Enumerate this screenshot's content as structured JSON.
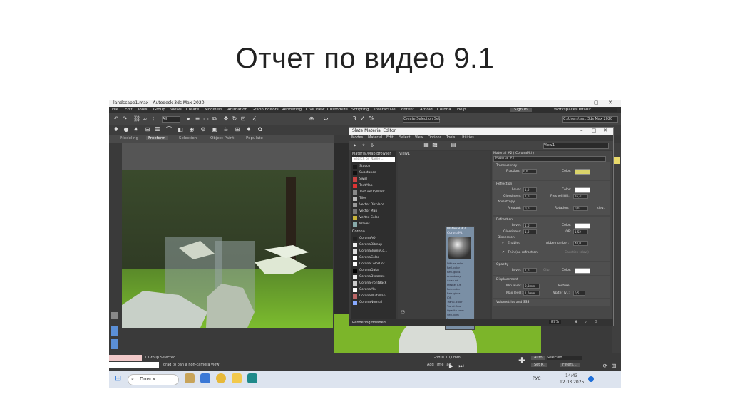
{
  "slide": {
    "title": "Отчет по видео 9.1"
  },
  "app": {
    "window_title": "landscape1.max - Autodesk 3ds Max 2020",
    "menu": [
      "File",
      "Edit",
      "Tools",
      "Group",
      "Views",
      "Create",
      "Modifiers",
      "Animation",
      "Graph Editors",
      "Rendering",
      "Civil View",
      "Customize",
      "Scripting",
      "Interactive",
      "Content",
      "Arnold",
      "Corona",
      "Help"
    ],
    "sign_in": "Sign In",
    "workspaces_label": "Workspaces:",
    "workspace_value": "Default",
    "path_value": "C:\\Users\\Iss...3ds Max 2020",
    "selection_filter": "All",
    "create_selection_set": "Create Selection Set",
    "ribbon_tabs": [
      "Modeling",
      "Freeform",
      "Selection",
      "Object Paint",
      "Populate"
    ]
  },
  "slate": {
    "title": "Slate Material Editor",
    "menu": [
      "Modes",
      "Material",
      "Edit",
      "Select",
      "View",
      "Options",
      "Tools",
      "Utilities"
    ],
    "view_dropdown": "View1",
    "browser_header": "Material/Map Browser",
    "search_placeholder": "Search by Name ...",
    "maps": [
      "Stucco",
      "Substance",
      "Swirl",
      "TextMap",
      "TextureObjMask",
      "Tiles",
      "Vector Displace...",
      "Vector Map",
      "Vertex Color",
      "Waves"
    ],
    "corona_group": "Corona",
    "corona_maps": [
      "CoronaAO",
      "CoronaBitmap",
      "CoronaBumpCo...",
      "CoronaColor",
      "CoronaColorCor...",
      "CoronaData",
      "CoronaDistance",
      "CoronaFrontBack",
      "CoronaMix",
      "CoronaMultiMap",
      "CoronaNormal"
    ],
    "view_tab": "View1",
    "node_title": "Material #2",
    "node_subtitle": "CoronaMtl",
    "node_slots": [
      "Diffuse color",
      "Refl. color",
      "Refl. gloss",
      "Anisotropy",
      "Aniso rot.",
      "Fresnel IOR",
      "Refr. color",
      "Refr. gloss",
      "IOR",
      "Transl. color",
      "Transl. frac",
      "Opacity color",
      "Self-illum",
      "Bump",
      "Displacement"
    ],
    "props_header": "Material #2 ( CoronaMtl )",
    "props_name": "Material #2",
    "sections": {
      "translucency": "Translucency",
      "fraction_label": "Fraction:",
      "fraction_value": "0,0",
      "color_label": "Color:",
      "reflection": "Reflection",
      "level_label": "Level:",
      "refl_level": "1,0",
      "glossiness_label": "Glossiness:",
      "refl_gloss": "1,0",
      "fresnel_label": "Fresnel IOR:",
      "fresnel_value": "16,42",
      "anisotropy": "Anisotropy",
      "amount_label": "Amount:",
      "amount_value": "0,0",
      "rotation_label": "Rotation:",
      "rotation_value": "0,0",
      "deg": "deg.",
      "refraction": "Refraction",
      "refr_level": "1,0",
      "refr_gloss": "1,0",
      "ior_label": "IOR:",
      "ior_value": "1,52",
      "dispersion": "Dispersion",
      "enabled": "Enabled",
      "abbe_label": "Abbe number:",
      "abbe_value": "40,0",
      "thin": "Thin (no refraction)",
      "caustics": "Caustics (slow)",
      "opacity": "Opacity",
      "op_level": "1,0",
      "clip": "Clip",
      "displacement": "Displacement",
      "min_level_label": "Min level:",
      "min_level": "0,0mm",
      "max_level_label": "Max level:",
      "max_level": "1,0mm",
      "texture_label": "Texture:",
      "water_label": "Water lvl.:",
      "water_value": "0,5",
      "vol_sss": "Volumetrics and SSS"
    },
    "zoom": "89%",
    "status": "Rendering finished",
    "colors": {
      "translucency": "#d9d36a",
      "reflection": "#ffffff",
      "refraction": "#ffffff",
      "opacity": "#ffffff"
    }
  },
  "status": {
    "group_selected": "1 Group Selected",
    "prompt": "drag to pan a non-camera view",
    "grid": "Grid = 10,0mm",
    "add_time_tag": "Add Time Tag",
    "auto": "Auto",
    "selected": "Selected",
    "set_k": "Set K.",
    "filters": "Filters..."
  },
  "taskbar": {
    "search": "Поиск",
    "lang": "РУС",
    "time": "14:43",
    "date": "12.03.2025"
  }
}
